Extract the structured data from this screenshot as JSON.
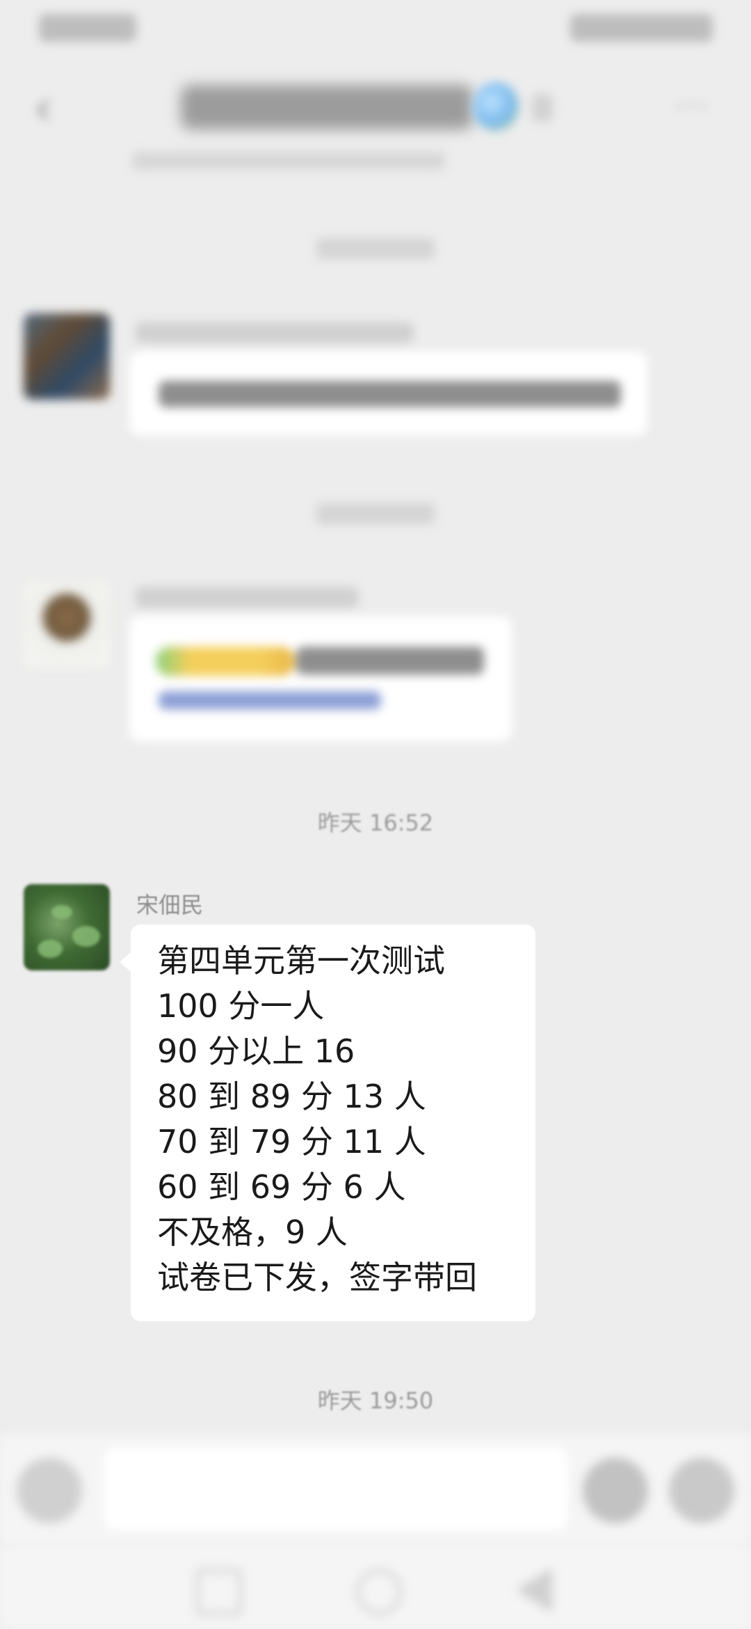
{
  "status_bar": {
    "left_text": "",
    "right_text": ""
  },
  "header": {
    "back_icon": "back-arrow-icon",
    "title": "",
    "more_icon": "more-icon"
  },
  "messages": [
    {
      "type": "time",
      "text": ""
    },
    {
      "type": "text",
      "sender": "",
      "content": ""
    },
    {
      "type": "time",
      "text": ""
    },
    {
      "type": "link",
      "sender": "",
      "content": ""
    },
    {
      "type": "time",
      "text": "昨天 16:52"
    },
    {
      "type": "text",
      "sender": "宋佃民",
      "lines": [
        "第四单元第一次测试",
        "100 分一人",
        "90 分以上 16",
        "80 到 89 分 13 人",
        "70 到 79 分 11 人",
        "60 到 69 分 6 人",
        "不及格，9 人",
        "试卷已下发，签字带回"
      ]
    },
    {
      "type": "time",
      "text": "昨天 19:50"
    }
  ],
  "input_bar": {
    "voice_icon": "voice-icon",
    "emoji_icon": "emoji-icon",
    "plus_icon": "plus-icon"
  },
  "nav_bar": {
    "recent_icon": "recent-apps-icon",
    "home_icon": "home-icon",
    "back_icon": "back-icon"
  },
  "colors": {
    "background": "#ededed",
    "bubble": "#ffffff",
    "timestamp_text": "#9b9b9b",
    "sender_name_text": "#8d8d8d"
  }
}
